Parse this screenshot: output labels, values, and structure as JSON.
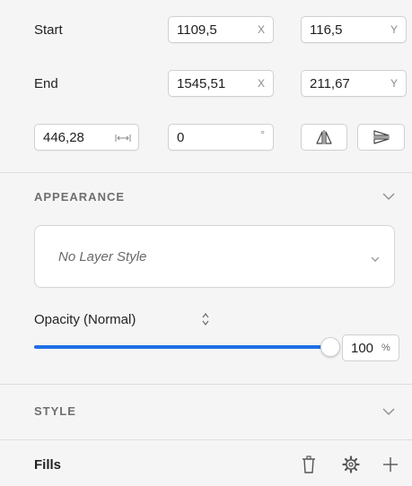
{
  "position": {
    "start": {
      "label": "Start",
      "x_value": "1109,5",
      "x_suffix": "X",
      "y_value": "116,5",
      "y_suffix": "Y"
    },
    "end": {
      "label": "End",
      "x_value": "1545,51",
      "x_suffix": "X",
      "y_value": "211,67",
      "y_suffix": "Y"
    },
    "length": {
      "value": "446,28",
      "icon": "width-arrows-icon"
    },
    "rotation": {
      "value": "0",
      "suffix": "°"
    },
    "flip_horizontal_icon": "flip-horizontal-icon",
    "flip_vertical_icon": "flip-vertical-icon"
  },
  "appearance": {
    "title": "APPEARANCE",
    "layer_style": "No Layer Style",
    "opacity_label": "Opacity (Normal)",
    "opacity_value": "100",
    "opacity_suffix": "%",
    "opacity_level": 1.0
  },
  "style": {
    "title": "STYLE",
    "fills_label": "Fills",
    "icons": [
      "trash-icon",
      "gear-icon",
      "plus-icon"
    ]
  },
  "colors": {
    "accent": "#1f6fe5",
    "panel_bg": "#f5f5f5",
    "border": "#d0d0d0"
  }
}
